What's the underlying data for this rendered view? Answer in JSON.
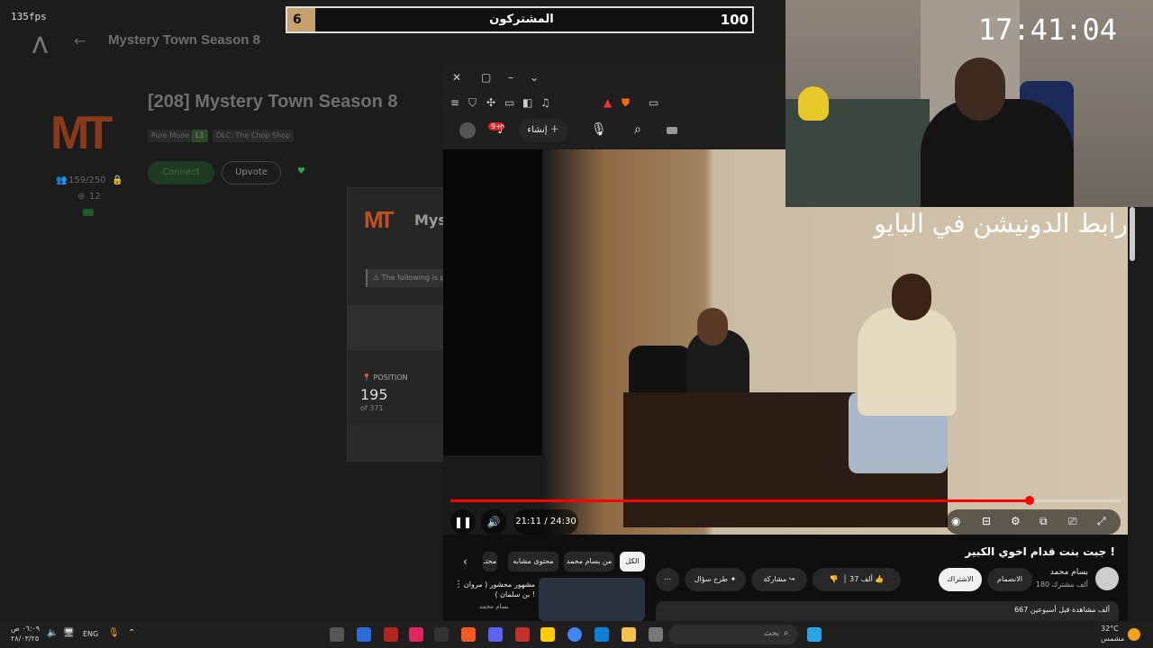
{
  "overlay": {
    "fps": "135fps",
    "clock": "17:41:04"
  },
  "launcher": {
    "breadcrumb": "Mystery Town Season 8",
    "server_title": "[208] Mystery Town Season 8",
    "logo_text": "MT",
    "tags": [
      "Pure Mode",
      "L1",
      "DLC: The Chop Shop"
    ],
    "players": "159/250",
    "rating": "12",
    "connect_label": "Connect",
    "upvote_label": "Upvote"
  },
  "modal": {
    "logo_text": "MT",
    "title": "Mys",
    "notice": "The following is p",
    "position_label": "POSITION",
    "position_value": "195",
    "position_of": "of 371"
  },
  "goal": {
    "current": "6",
    "label": "المشتركون",
    "target": "100",
    "progress": 0.06
  },
  "browser": {
    "create_label": "إنشاء",
    "notif_count": "9+"
  },
  "video": {
    "caption": "رابط الدونيشن في البايو",
    "time": "21:11 / 24:30",
    "progress": 0.864
  },
  "below": {
    "title": "جبت بنت قدام اخوي الكبير !",
    "channel_name": "بسام محمد",
    "channel_subs": "180 ألف مشترك",
    "join_label": "الانضمام",
    "subscribe_label": "الاشتراك",
    "likes": "37 ألف",
    "share_label": "مشاركة",
    "ask_label": "طرح سؤال",
    "views": "667 ألف مشاهدة قبل أسبوعين",
    "chips": [
      "الكل",
      "من بسام محمد",
      "محتوى مشابه",
      "محتـ"
    ],
    "related_title": "مشهور محشور ( مروان بن سلمان ) !",
    "related_channel": "بسام محمد"
  },
  "taskbar": {
    "time": "٠٦:٠٩ ص",
    "date": "٢٨/٠٣/٢٥",
    "lang": "ENG",
    "search_placeholder": "بحث",
    "temp": "32°C",
    "weather": "مشمس"
  },
  "colors": {
    "accent_red": "#ff0000",
    "goal_fill": "#c5a16b",
    "brand_orange": "#c0501f"
  }
}
